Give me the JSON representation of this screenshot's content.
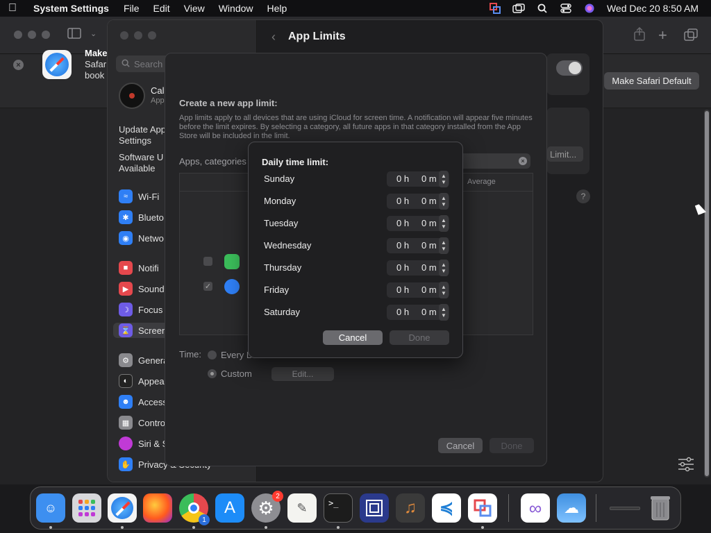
{
  "menubar": {
    "app_name": "System Settings",
    "menus": [
      "File",
      "Edit",
      "View",
      "Window",
      "Help"
    ],
    "clock": "Wed Dec 20  8:50 AM"
  },
  "safari": {
    "banner_title": "Make",
    "banner_line2": "Safari",
    "banner_line3": "book",
    "make_default_label": "Make Safari Default"
  },
  "settings": {
    "search_placeholder": "Search",
    "account_name": "Cal",
    "account_sub": "App",
    "update_text_1": "Update App",
    "update_text_2": "Settings",
    "software_text_1": "Software U",
    "software_text_2": "Available",
    "sidebar_items": [
      {
        "label": "Wi-Fi",
        "icon": "wifi-icon",
        "color": "#2f7ff5"
      },
      {
        "label": "Blueto",
        "icon": "bluetooth-icon",
        "color": "#2f7ff5"
      },
      {
        "label": "Netwo",
        "icon": "globe-icon",
        "color": "#2f7ff5"
      },
      {
        "label": "Notifi",
        "icon": "bell-icon",
        "color": "#e5484d"
      },
      {
        "label": "Sound",
        "icon": "speaker-icon",
        "color": "#e5484d"
      },
      {
        "label": "Focus",
        "icon": "moon-icon",
        "color": "#6e5ce6"
      },
      {
        "label": "Screen",
        "icon": "hourglass-icon",
        "color": "#6e5ce6"
      },
      {
        "label": "Genera",
        "icon": "gear-icon",
        "color": "#8a8a8e"
      },
      {
        "label": "Appea",
        "icon": "appearance-icon",
        "color": "#222"
      },
      {
        "label": "Access",
        "icon": "accessibility-icon",
        "color": "#2f7ff5"
      },
      {
        "label": "Contro",
        "icon": "control-center-icon",
        "color": "#8a8a8e"
      },
      {
        "label": "Siri & S",
        "icon": "siri-icon",
        "color": "#c03ad6"
      },
      {
        "label": "Privacy & Security",
        "icon": "hand-icon",
        "color": "#2f7ff5"
      }
    ],
    "header_title": "App Limits",
    "limit_button": "Limit...",
    "help": "?"
  },
  "sheet": {
    "title": "Create a new app limit:",
    "description": "App limits apply to all devices that are using iCloud for screen time. A notification will appear five minutes before the limit expires. By selecting a category, all future apps in that category installed from the App Store will be included in the limit.",
    "apps_label": "Apps, categories",
    "average_header": "Average",
    "time_label": "Time:",
    "every_day_label": "Every D",
    "custom_label": "Custom",
    "edit_label": "Edit...",
    "cancel_label": "Cancel",
    "done_label": "Done"
  },
  "dialog": {
    "title": "Daily time limit:",
    "days": [
      {
        "day": "Sunday",
        "hours": "0 h",
        "minutes": "0 m"
      },
      {
        "day": "Monday",
        "hours": "0 h",
        "minutes": "0 m"
      },
      {
        "day": "Tuesday",
        "hours": "0 h",
        "minutes": "0 m"
      },
      {
        "day": "Wednesday",
        "hours": "0 h",
        "minutes": "0 m"
      },
      {
        "day": "Thursday",
        "hours": "0 h",
        "minutes": "0 m"
      },
      {
        "day": "Friday",
        "hours": "0 h",
        "minutes": "0 m"
      },
      {
        "day": "Saturday",
        "hours": "0 h",
        "minutes": "0 m"
      }
    ],
    "cancel_label": "Cancel",
    "done_label": "Done"
  },
  "dock": {
    "items": [
      {
        "name": "finder",
        "color": "#3d8ff0"
      },
      {
        "name": "launchpad",
        "color": "#e0e0e0"
      },
      {
        "name": "safari",
        "color": "#f4f4f4"
      },
      {
        "name": "firefox",
        "color": "#ff7139"
      },
      {
        "name": "chrome",
        "color": "#ffffff"
      },
      {
        "name": "app-store",
        "color": "#1d8cf8"
      },
      {
        "name": "system-settings",
        "color": "#8e8e93"
      },
      {
        "name": "textedit",
        "color": "#f4f4f0"
      },
      {
        "name": "terminal",
        "color": "#1c1c1c"
      },
      {
        "name": "remote-desktop",
        "color": "#2b3a8c"
      },
      {
        "name": "instruments",
        "color": "#3a3a3a"
      },
      {
        "name": "vscode",
        "color": "#ffffff"
      },
      {
        "name": "parallels",
        "color": "#ffffff"
      },
      {
        "name": "visual-studio",
        "color": "#ffffff"
      },
      {
        "name": "weather",
        "color": "#3f8fe0"
      },
      {
        "name": "downloads",
        "color": "#3a3a3c"
      },
      {
        "name": "trash",
        "color": "#6a6a6e"
      }
    ],
    "settings_badge": "2",
    "chrome_badge": "1"
  }
}
